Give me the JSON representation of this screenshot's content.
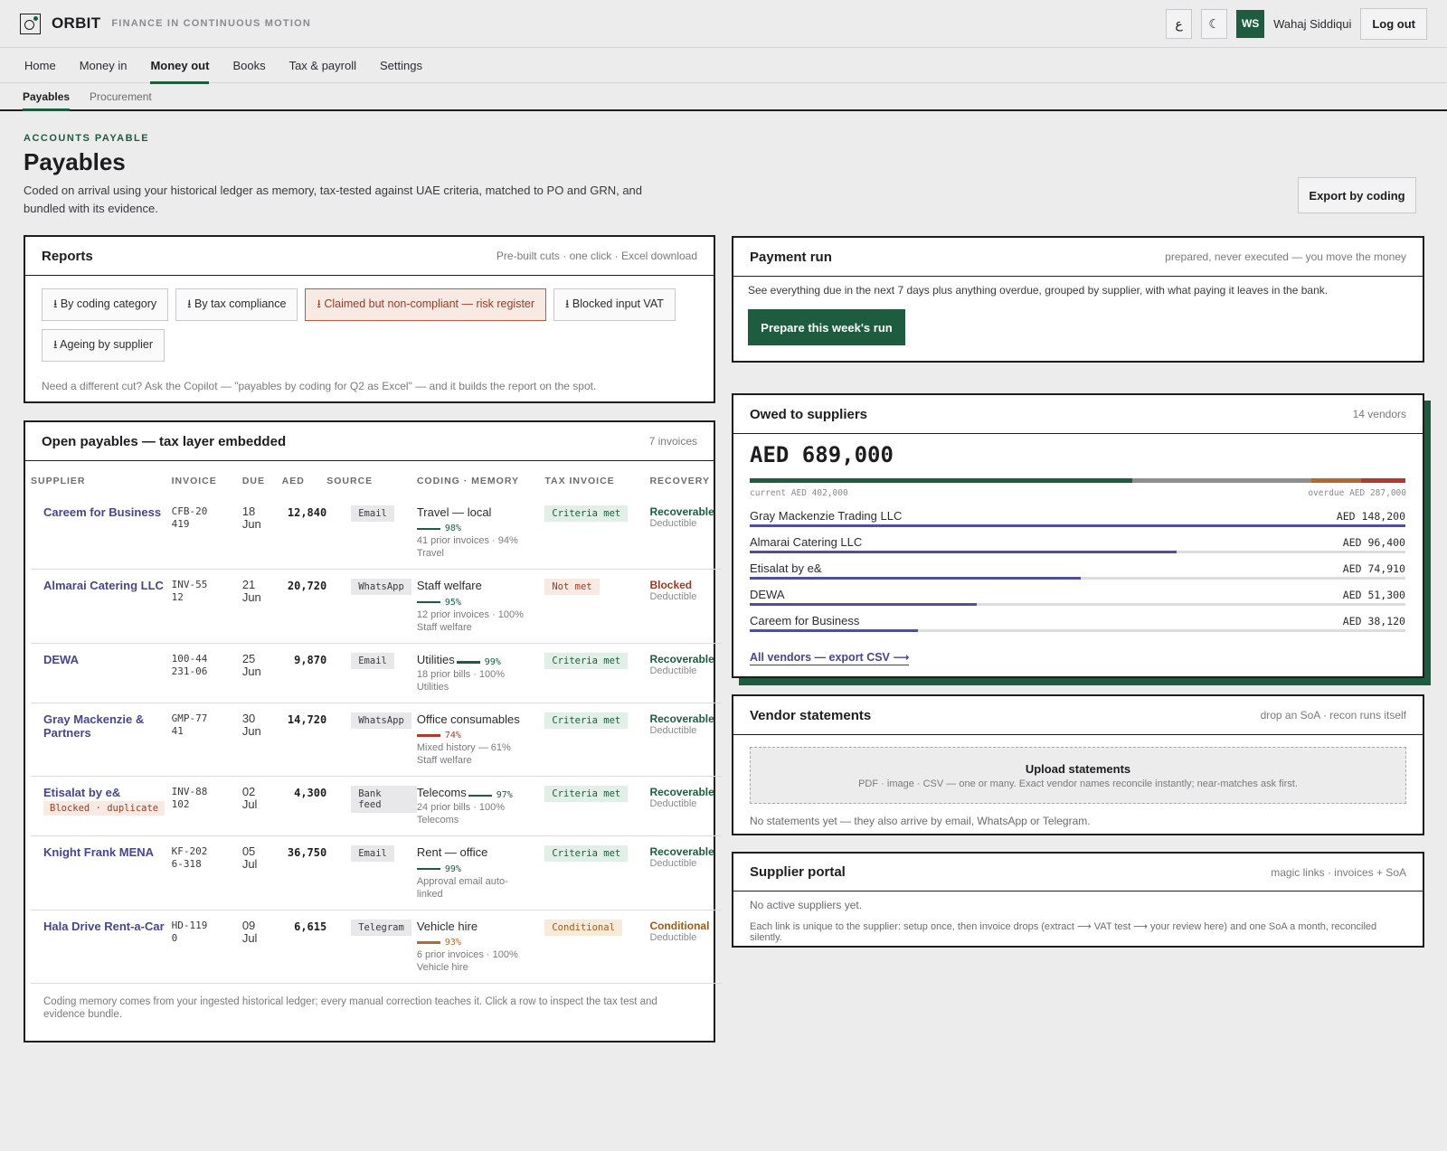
{
  "app": {
    "brand": "ORBIT",
    "tagline": "FINANCE IN CONTINUOUS MOTION"
  },
  "topbar": {
    "lang_toggle": "ع",
    "theme_toggle": "☾",
    "avatar_initials": "WS",
    "user_name": "Wahaj Siddiqui",
    "logout_label": "Log out"
  },
  "nav": [
    "Home",
    "Money in",
    "Money out",
    "Books",
    "Tax & payroll",
    "Settings"
  ],
  "subnav": [
    "Payables",
    "Procurement"
  ],
  "header": {
    "eyebrow": "ACCOUNTS PAYABLE",
    "title": "Payables",
    "description": "Coded on arrival using your historical ledger as memory, tax-tested against UAE criteria, matched to PO and GRN, and bundled with its evidence.",
    "export_label": "Export by coding"
  },
  "reports": {
    "title": "Reports",
    "meta": "Pre-built cuts · one click · Excel download",
    "buttons": [
      "⭳ By coding category",
      "⭳ By tax compliance",
      "⭳ Claimed but non-compliant — risk register",
      "⭳ Blocked input VAT",
      "⭳ Ageing by supplier"
    ],
    "note": "Need a different cut? Ask the Copilot — \"payables by coding for Q2 as Excel\" — and it builds the report on the spot."
  },
  "payables": {
    "title": "Open payables — tax layer embedded",
    "meta": "7 invoices",
    "columns": [
      "SUPPLIER",
      "INVOICE",
      "DUE",
      "AED",
      "SOURCE",
      "CODING · MEMORY",
      "TAX INVOICE",
      "RECOVERY"
    ],
    "rows": [
      {
        "supplier": "Careem for Business",
        "invoice": "CFB-20419",
        "due_day": "18",
        "due_month": "Jun",
        "amount": "12,840",
        "source": "Email",
        "coding": "Travel — local",
        "confidence": "98%",
        "memory": "41 prior invoices · 94% Travel",
        "tax": "Criteria met",
        "recovery": "Recoverable",
        "recovery_sub": "Deductible"
      },
      {
        "supplier": "Almarai Catering LLC",
        "invoice": "INV-5512",
        "due_day": "21",
        "due_month": "Jun",
        "amount": "20,720",
        "source": "WhatsApp",
        "coding": "Staff welfare",
        "confidence": "95%",
        "memory": "12 prior invoices · 100% Staff welfare",
        "tax": "Not met",
        "recovery": "Blocked",
        "recovery_sub": "Deductible"
      },
      {
        "supplier": "DEWA",
        "invoice": "100-44231-06",
        "due_day": "25",
        "due_month": "Jun",
        "amount": "9,870",
        "source": "Email",
        "coding": "Utilities",
        "confidence": "99%",
        "memory": "18 prior bills · 100% Utilities",
        "tax": "Criteria met",
        "recovery": "Recoverable",
        "recovery_sub": "Deductible"
      },
      {
        "supplier": "Gray Mackenzie & Partners",
        "invoice": "GMP-7741",
        "due_day": "30",
        "due_month": "Jun",
        "amount": "14,720",
        "source": "WhatsApp",
        "coding": "Office consumables",
        "confidence": "74%",
        "memory": "Mixed history — 61% Staff welfare",
        "tax": "Criteria met",
        "recovery": "Recoverable",
        "recovery_sub": "Deductible"
      },
      {
        "supplier": "Etisalat by e&",
        "badge": "Blocked · duplicate",
        "invoice": "INV-88102",
        "due_day": "02",
        "due_month": "Jul",
        "amount": "4,300",
        "source": "Bank feed",
        "coding": "Telecoms",
        "confidence": "97%",
        "memory": "24 prior bills · 100% Telecoms",
        "tax": "Criteria met",
        "recovery": "Recoverable",
        "recovery_sub": "Deductible"
      },
      {
        "supplier": "Knight Frank MENA",
        "invoice": "KF-2026-318",
        "due_day": "05",
        "due_month": "Jul",
        "amount": "36,750",
        "source": "Email",
        "coding": "Rent — office",
        "confidence": "99%",
        "memory": "Approval email auto-linked",
        "tax": "Criteria met",
        "recovery": "Recoverable",
        "recovery_sub": "Deductible"
      },
      {
        "supplier": "Hala Drive Rent-a-Car",
        "invoice": "HD-1190",
        "due_day": "09",
        "due_month": "Jul",
        "amount": "6,615",
        "source": "Telegram",
        "coding": "Vehicle hire",
        "confidence": "93%",
        "memory": "6 prior invoices · 100% Vehicle hire",
        "tax": "Conditional",
        "recovery": "Conditional",
        "recovery_sub": "Deductible"
      }
    ],
    "footnote": "Coding memory comes from your ingested historical ledger; every manual correction teaches it. Click a row to inspect the tax test and evidence bundle."
  },
  "payment_run": {
    "title": "Payment run",
    "meta": "prepared, never executed — you move the money",
    "description": "See everything due in the next 7 days plus anything overdue, grouped by supplier, with what paying it leaves in the bank.",
    "button_label": "Prepare this week's run"
  },
  "owed": {
    "title": "Owed to suppliers",
    "meta": "14 vendors",
    "total": "AED 689,000",
    "current_label": "current AED 402,000",
    "overdue_label": "overdue AED 287,000",
    "ageing_segments": [
      {
        "value": 402000,
        "color": "#1d5c3f"
      },
      {
        "value": 188000,
        "color": "#8e8e8a"
      },
      {
        "value": 52000,
        "color": "#b2692a"
      },
      {
        "value": 47000,
        "color": "#b03a2e"
      }
    ],
    "vendors": [
      {
        "name": "Gray Mackenzie Trading LLC",
        "amount": "AED 148,200",
        "value": 148200
      },
      {
        "name": "Almarai Catering LLC",
        "amount": "AED 96,400",
        "value": 96400
      },
      {
        "name": "Etisalat by e&",
        "amount": "AED 74,910",
        "value": 74910
      },
      {
        "name": "DEWA",
        "amount": "AED 51,300",
        "value": 51300
      },
      {
        "name": "Careem for Business",
        "amount": "AED 38,120",
        "value": 38120
      }
    ],
    "link_label": "All vendors — export CSV ⟶"
  },
  "statements": {
    "title": "Vendor statements",
    "meta": "drop an SoA · recon runs itself",
    "upload_title": "Upload statements",
    "upload_sub": "PDF · image · CSV — one or many. Exact vendor names reconcile instantly; near-matches ask first.",
    "note": "No statements yet — they also arrive by email, WhatsApp or Telegram."
  },
  "portal": {
    "title": "Supplier portal",
    "meta": "magic links · invoices + SoA",
    "line1": "No active suppliers yet.",
    "line2": "Each link is unique to the supplier: setup once, then invoice drops (extract ⟶ VAT test ⟶ your review here) and one SoA a month, reconciled silently."
  },
  "colors": {
    "accent": "#1d5c3f",
    "link": "#46468a",
    "risk": "#9b3a22",
    "warning": "#a05b15"
  }
}
